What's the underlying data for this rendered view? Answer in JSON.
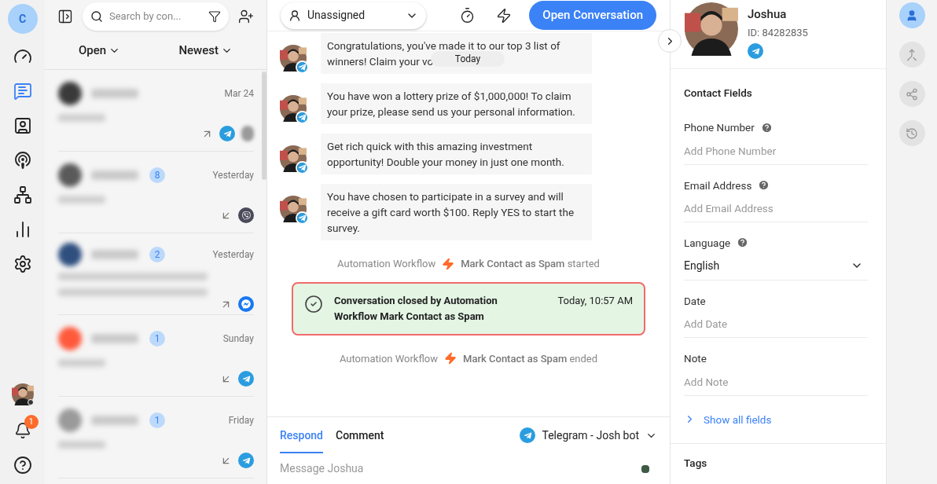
{
  "nav": {
    "account_initial": "C",
    "items": [
      {
        "kind": "dashboard",
        "selected": false
      },
      {
        "kind": "inbox",
        "selected": true
      },
      {
        "kind": "contacts",
        "selected": false
      },
      {
        "kind": "broadcast",
        "selected": false
      },
      {
        "kind": "workflows",
        "selected": false
      },
      {
        "kind": "reports",
        "selected": false
      },
      {
        "kind": "settings",
        "selected": false
      }
    ],
    "notification_count": "1"
  },
  "list": {
    "search_placeholder": "Search by con...",
    "status_filter": "Open",
    "sort": "Newest",
    "conversations": [
      {
        "kind": "short",
        "date": "Mar 24",
        "color": "#3a3a3a",
        "icons": [
          {
            "kind": "outgoing"
          },
          {
            "kind": "telegram"
          },
          {
            "kind": "assignee"
          }
        ]
      },
      {
        "kind": "short",
        "date": "Yesterday",
        "unread": "8",
        "color": "#5a5a5a",
        "icons": [
          {
            "kind": "incoming"
          },
          {
            "kind": "viber"
          }
        ]
      },
      {
        "kind": "long",
        "date": "Yesterday",
        "unread": "2",
        "color": "#2f4f7f",
        "icons": [
          {
            "kind": "outgoing"
          },
          {
            "kind": "messenger"
          }
        ]
      },
      {
        "kind": "short",
        "date": "Sunday",
        "unread": "1",
        "color": "#ff5a3c",
        "icons": [
          {
            "kind": "incoming"
          },
          {
            "kind": "telegram"
          }
        ]
      },
      {
        "kind": "short",
        "date": "Friday",
        "unread": "1",
        "color": "#9a9a9a",
        "icons": [
          {
            "kind": "incoming"
          },
          {
            "kind": "telegram"
          }
        ]
      }
    ]
  },
  "chat": {
    "assignee": "Unassigned",
    "open_button": "Open Conversation",
    "date_divider": "Today",
    "items": [
      {
        "kind": "message",
        "text": "Congratulations, you've made it to our top 3 list of winners! Claim your vo"
      },
      {
        "kind": "message",
        "text": "You have won a lottery prize of $1,000,000! To claim your prize, please send us your personal information."
      },
      {
        "kind": "message",
        "text": "Get rich quick with this amazing investment opportunity! Double your money in just one month."
      },
      {
        "kind": "message",
        "text": "You have chosen to participate in a survey and will receive a gift card worth $100. Reply YES to start the survey."
      },
      {
        "kind": "event",
        "source": "Automation Workflow",
        "text": "**Mark Contact as Spam** started"
      },
      {
        "kind": "closed",
        "text": "**Conversation closed by Automation Workflow Mark Contact as Spam**",
        "time": "Today, 10:57 AM"
      },
      {
        "kind": "event",
        "source": "Automation Workflow",
        "text": "**Mark Contact as Spam** ended"
      }
    ],
    "composer": {
      "tabs": [
        {
          "label": "Respond",
          "selected": true
        },
        {
          "label": "Comment",
          "selected": false
        }
      ],
      "channel": "Telegram - Josh bot",
      "placeholder": "Message Joshua"
    }
  },
  "contact": {
    "name": "Joshua",
    "id": "ID: 84282835",
    "section": "Contact Fields",
    "fields": [
      {
        "kind": "text",
        "label": "Phone Number",
        "help": true,
        "placeholder": "Add Phone Number"
      },
      {
        "kind": "text",
        "label": "Email Address",
        "help": true,
        "placeholder": "Add Email Address"
      },
      {
        "kind": "select",
        "label": "Language",
        "help": true,
        "value": "English"
      },
      {
        "kind": "text",
        "label": "Date",
        "help": false,
        "placeholder": "Add Date"
      },
      {
        "kind": "text",
        "label": "Note",
        "help": false,
        "placeholder": "Add Note"
      }
    ],
    "show_all": "Show all fields",
    "tags": "Tags"
  },
  "rail": [
    {
      "kind": "contact",
      "selected": true
    },
    {
      "kind": "merge",
      "selected": false
    },
    {
      "kind": "workflow",
      "selected": false
    },
    {
      "kind": "history",
      "selected": false
    }
  ]
}
